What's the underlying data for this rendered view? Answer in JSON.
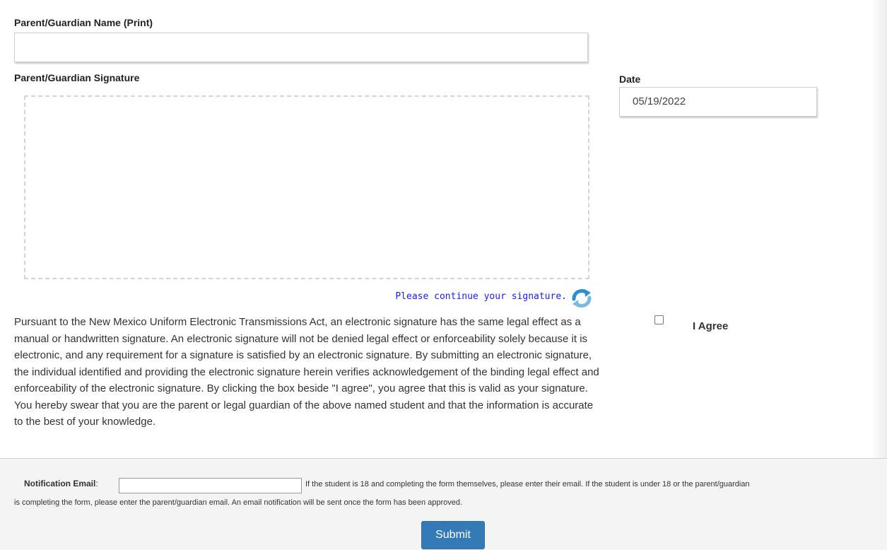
{
  "name_field": {
    "label": "Parent/Guardian Name (Print)",
    "value": ""
  },
  "signature": {
    "label": "Parent/Guardian Signature",
    "continue_text": "Please continue your signature."
  },
  "date_field": {
    "label": "Date",
    "value": "05/19/2022"
  },
  "legal_text": "Pursuant to the New Mexico Uniform Electronic Transmissions Act, an electronic signature has the same legal effect as a manual or handwritten signature. An electronic signature will not be denied legal effect or enforceability solely because it is electronic, and any requirement for a signature is satisfied by an electronic signature. By submitting an electronic signature, the individual identified and providing the electronic signature herein verifies acknowledgement of the binding legal effect and enforceability of the electronic signature. By clicking the box beside \"I agree\", you agree that this is valid as your signature. You hereby swear that you are the parent or legal guardian of the above named student and that the information is accurate to the best of your knowledge.",
  "agree": {
    "label": "I Agree",
    "checked": false
  },
  "notification": {
    "label": "Notification Email",
    "colon": ":",
    "value": "",
    "help_line1": "If the student is 18 and completing the form themselves, please enter their email. If the student is under 18 or the parent/guardian",
    "help_line2": "is completing the form, please enter the parent/guardian email. An email notification will be sent once the form has been approved."
  },
  "submit_label": "Submit",
  "icons": {
    "refresh": "refresh-icon"
  },
  "colors": {
    "primary_button": "#337ab7",
    "link_text": "#1a1aff"
  }
}
